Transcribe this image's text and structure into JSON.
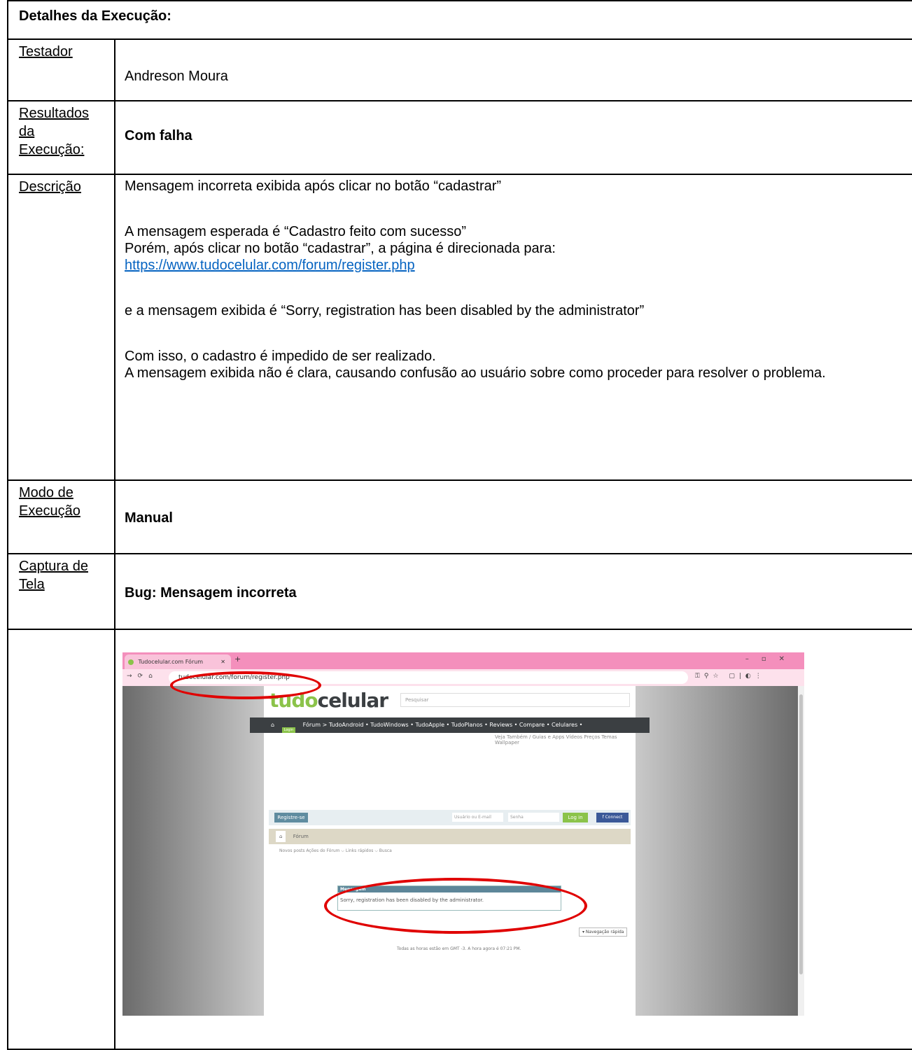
{
  "heading": "Detalhes da Execução:",
  "rows": {
    "testador": {
      "label": "Testador",
      "value": "Andreson Moura"
    },
    "resultados": {
      "label_l1": "Resultados",
      "label_l2": "da",
      "label_l3": "Execução:",
      "value": "Com falha"
    },
    "descricao": {
      "label": "Descrição",
      "line1": "Mensagem incorreta exibida após clicar no botão “cadastrar”",
      "line2": "A mensagem esperada é “Cadastro feito com sucesso”",
      "line3": "Porém, após clicar no botão “cadastrar”, a página é direcionada para:",
      "link": "https://www.tudocelular.com/forum/register.php",
      "line4": "e a  mensagem exibida é “Sorry, registration has been disabled by the administrator”",
      "line5": "Com isso, o cadastro é impedido de ser realizado.",
      "line6": "A mensagem exibida não é clara, causando confusão ao usuário sobre como proceder para resolver o problema."
    },
    "modo": {
      "label_l1": "Modo de",
      "label_l2": "Execução",
      "value": "Manual"
    },
    "captura": {
      "label_l1": "Captura de",
      "label_l2": "Tela",
      "value": "Bug: Mensagem incorreta"
    }
  },
  "screenshot": {
    "tab_title": "Tudocelular.com Fórum",
    "url": "tudocelular.com/forum/register.php",
    "logo_a": "tudo",
    "logo_b": "celular",
    "search_placeholder": "Pesquisar",
    "nav_items": "Fórum  >    TudoAndroid •   TudoWindows •   TudoApple •   TudoPlanos •   Reviews •   Compare •   Celulares •",
    "subnav": "Veja Também  /  Guias e Apps   Vídeos   Preços   Temas   Wallpaper",
    "register_btn": "Registre-se",
    "user_placeholder": "Usuário ou E-mail",
    "pass_placeholder": "Senha",
    "login_btn": "Log in",
    "fb_btn": "f  Connect",
    "forum_crumb": "Fórum",
    "menu": "Novos posts    Ações do Fórum ⌵      Links rápidos ⌵       Busca",
    "msg_title": "Mensagem",
    "msg_text": "Sorry, registration has been disabled by the administrator.",
    "quick_nav": "▾ Navegação rápida",
    "footer": "Todas as horas estão em GMT -3. A hora agora é 07:21 PM."
  }
}
